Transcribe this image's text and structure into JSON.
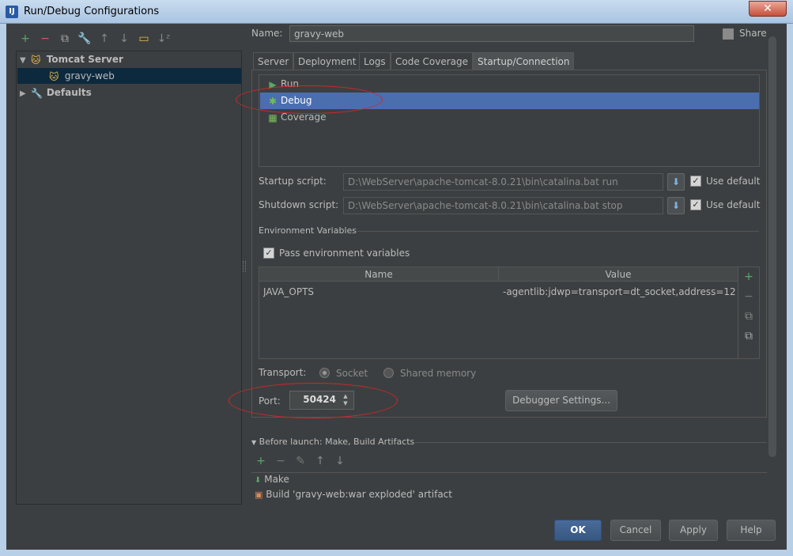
{
  "window": {
    "title": "Run/Debug Configurations",
    "app_icon_text": "IJ",
    "close_glyph": "✕"
  },
  "toolbar": {
    "items": [
      {
        "name": "add",
        "glyph": "+",
        "color": "#59a869"
      },
      {
        "name": "remove",
        "glyph": "−",
        "color": "#db5860"
      },
      {
        "name": "copy",
        "glyph": "⧉",
        "color": "#aaaaaa"
      },
      {
        "name": "edit-defaults",
        "glyph": "🔧",
        "color": "#bbbbbb"
      },
      {
        "name": "move-up",
        "glyph": "↑",
        "color": "#888888"
      },
      {
        "name": "move-down",
        "glyph": "↓",
        "color": "#888888"
      },
      {
        "name": "folder",
        "glyph": "▭",
        "color": "#e8b84a"
      },
      {
        "name": "sort",
        "glyph": "↓ᶻ",
        "color": "#888888"
      }
    ]
  },
  "tree": {
    "tomcat_server": "Tomcat Server",
    "gravy_web": "gravy-web",
    "defaults": "Defaults"
  },
  "config": {
    "name_label": "Name:",
    "name_value": "gravy-web",
    "share_label": "Share"
  },
  "tabs": [
    "Server",
    "Deployment",
    "Logs",
    "Code Coverage",
    "Startup/Connection"
  ],
  "modes": [
    "Run",
    "Debug",
    "Coverage"
  ],
  "startup": {
    "startup_label": "Startup script:",
    "startup_value": "D:\\WebServer\\apache-tomcat-8.0.21\\bin\\catalina.bat run",
    "shutdown_label": "Shutdown script:",
    "shutdown_value": "D:\\WebServer\\apache-tomcat-8.0.21\\bin\\catalina.bat stop",
    "use_default": "Use default"
  },
  "env": {
    "section_label": "Environment Variables",
    "pass_label": "Pass environment variables",
    "headers": [
      "Name",
      "Value"
    ],
    "rows": [
      {
        "name": "JAVA_OPTS",
        "value": "-agentlib:jdwp=transport=dt_socket,address=12..."
      }
    ]
  },
  "transport": {
    "label": "Transport:",
    "socket": "Socket",
    "shared_memory": "Shared memory"
  },
  "port": {
    "label": "Port:",
    "value": "50424"
  },
  "debugger_settings": "Debugger Settings...",
  "before_launch": {
    "title": "Before launch: Make, Build Artifacts",
    "items": [
      "Make",
      "Build 'gravy-web:war exploded' artifact"
    ]
  },
  "buttons": {
    "ok": "OK",
    "cancel": "Cancel",
    "apply": "Apply",
    "help": "Help"
  },
  "colors": {
    "accent_selection": "#4b6eaf",
    "tree_selection": "#0d293e",
    "annotation_red": "#d02828"
  }
}
